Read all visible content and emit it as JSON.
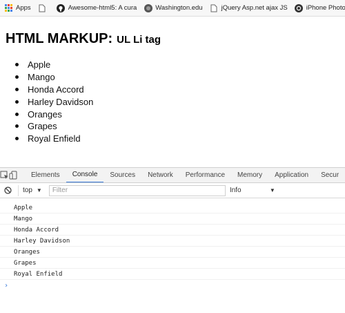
{
  "bookmarks": [
    {
      "label": "Apps",
      "icon": "apps-grid-icon"
    },
    {
      "label": "",
      "icon": "page-icon"
    },
    {
      "label": "Awesome-html5: A cura",
      "icon": "github-icon"
    },
    {
      "label": "Washington.edu",
      "icon": "washington-icon"
    },
    {
      "label": "jQuery Asp.net ajax JS",
      "icon": "page-icon"
    },
    {
      "label": "iPhone Photo",
      "icon": "chrome-icon"
    }
  ],
  "page": {
    "heading": "HTML MARKUP:",
    "heading_small": "UL Li tag",
    "items": [
      "Apple",
      "Mango",
      "Honda Accord",
      "Harley Davidson",
      "Oranges",
      "Grapes",
      "Royal Enfield"
    ]
  },
  "devtools": {
    "tabs": [
      "Elements",
      "Console",
      "Sources",
      "Network",
      "Performance",
      "Memory",
      "Application",
      "Secur"
    ],
    "active_tab": "Console",
    "context": "top",
    "filter_placeholder": "Filter",
    "levels": "Info",
    "log": [
      "Apple",
      "Mango",
      "Honda Accord",
      "Harley Davidson",
      "Oranges",
      "Grapes",
      "Royal Enfield"
    ],
    "prompt": "›"
  },
  "colors": {
    "accent": "#3879d9",
    "tabbar": "#f3f3f3"
  }
}
